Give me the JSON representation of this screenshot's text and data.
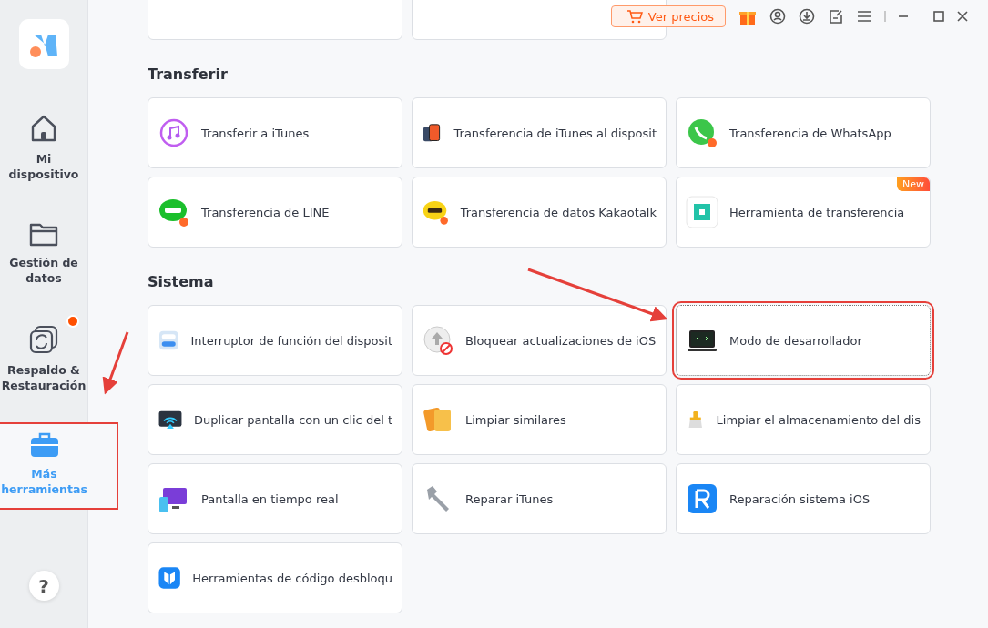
{
  "header": {
    "pricing_button": "Ver precios"
  },
  "sidebar": {
    "items": [
      {
        "label": "Mi dispositivo",
        "selected": false,
        "badge": false,
        "annotated": false
      },
      {
        "label": "Gestión de datos",
        "selected": false,
        "badge": false,
        "annotated": false
      },
      {
        "label": "Respaldo & Restauración",
        "selected": false,
        "badge": true,
        "annotated": false
      },
      {
        "label": "Más herramientas",
        "selected": true,
        "badge": false,
        "annotated": true
      }
    ],
    "help": "?"
  },
  "sections": [
    {
      "title": "Transferir",
      "tools": [
        {
          "label": "Transferir a iTunes",
          "annotated": false
        },
        {
          "label": "Transferencia de iTunes al disposit",
          "annotated": false
        },
        {
          "label": "Transferencia de WhatsApp",
          "annotated": false
        },
        {
          "label": "Transferencia de LINE",
          "annotated": false
        },
        {
          "label": "Transferencia de datos Kakaotalk",
          "annotated": false
        },
        {
          "label": "Herramienta de transferencia",
          "new_badge": "New",
          "annotated": false
        }
      ]
    },
    {
      "title": "Sistema",
      "tools": [
        {
          "label": "Interruptor de función del disposit",
          "annotated": false
        },
        {
          "label": "Bloquear actualizaciones de iOS",
          "annotated": false
        },
        {
          "label": "Modo de desarrollador",
          "annotated": true
        },
        {
          "label": "Duplicar pantalla con un clic del t",
          "annotated": false
        },
        {
          "label": "Limpiar similares",
          "annotated": false
        },
        {
          "label": "Limpiar el almacenamiento del dis",
          "annotated": false
        },
        {
          "label": "Pantalla en tiempo real",
          "annotated": false
        },
        {
          "label": "Reparar iTunes",
          "annotated": false
        },
        {
          "label": "Reparación sistema iOS",
          "annotated": false
        },
        {
          "label": "Herramientas de código desbloqu",
          "annotated": false
        }
      ]
    }
  ]
}
